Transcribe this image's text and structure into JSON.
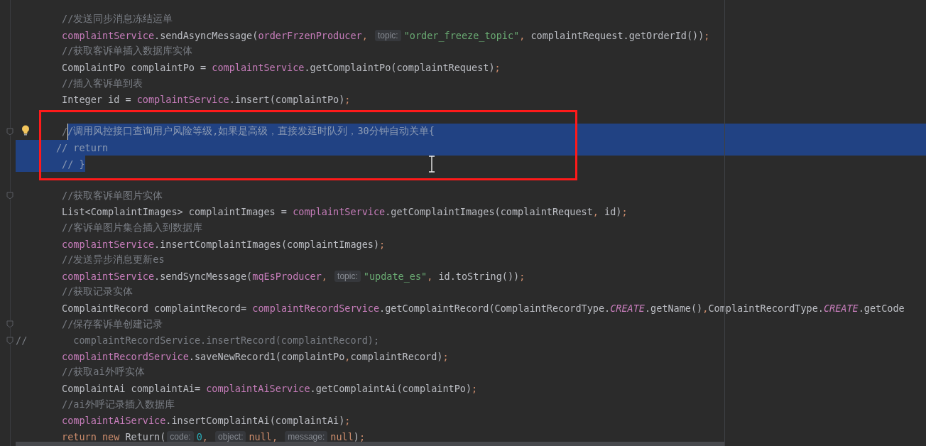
{
  "editor": {
    "lines": [
      {
        "kind": "code",
        "selected_to_end": false,
        "tokens": [
          {
            "kind": "comment",
            "text": "        //发送同步消息冻结运单"
          }
        ]
      },
      {
        "kind": "code",
        "selected_to_end": false,
        "tokens": [
          {
            "kind": "field",
            "text": "        complaintService"
          },
          {
            "kind": "plain",
            "text": ".sendAsyncMessage("
          },
          {
            "kind": "field",
            "text": "orderFrzenProducer"
          },
          {
            "kind": "punct",
            "text": ", "
          },
          {
            "kind": "hint",
            "text": "topic:"
          },
          {
            "kind": "string",
            "text": "\"order_freeze_topic\""
          },
          {
            "kind": "punct",
            "text": ", "
          },
          {
            "kind": "plain",
            "text": "complaintRequest.getOrderId())"
          },
          {
            "kind": "punct",
            "text": ";"
          }
        ]
      },
      {
        "kind": "code",
        "selected_to_end": false,
        "tokens": [
          {
            "kind": "comment",
            "text": "        //获取客诉单插入数据库实体"
          }
        ]
      },
      {
        "kind": "code",
        "selected_to_end": false,
        "tokens": [
          {
            "kind": "plain",
            "text": "        ComplaintPo complaintPo = "
          },
          {
            "kind": "field",
            "text": "complaintService"
          },
          {
            "kind": "plain",
            "text": ".getComplaintPo(complaintRequest)"
          },
          {
            "kind": "punct",
            "text": ";"
          }
        ]
      },
      {
        "kind": "code",
        "selected_to_end": false,
        "tokens": [
          {
            "kind": "comment",
            "text": "        //插入客诉单到表"
          }
        ]
      },
      {
        "kind": "code",
        "selected_to_end": false,
        "tokens": [
          {
            "kind": "plain",
            "text": "        Integer id = "
          },
          {
            "kind": "field",
            "text": "complaintService"
          },
          {
            "kind": "plain",
            "text": ".insert(complaintPo)"
          },
          {
            "kind": "punct",
            "text": ";"
          }
        ]
      },
      {
        "kind": "blank"
      },
      {
        "kind": "code",
        "selected_to_end": true,
        "markers": [
          {
            "kind": "fold"
          },
          {
            "kind": "bulb"
          }
        ],
        "tokens": [
          {
            "kind": "comment",
            "text": "        /"
          },
          {
            "kind": "comment",
            "selected": true,
            "text": "/调用风控接口查询用户风险等级,如果是高级，直接发延时队列，30分钟自动关单{"
          }
        ]
      },
      {
        "kind": "code",
        "selected_to_end": true,
        "tokens": [
          {
            "kind": "comment",
            "selected": true,
            "text": "       // return"
          }
        ]
      },
      {
        "kind": "code",
        "selected_to_end": false,
        "tokens": [
          {
            "kind": "comment",
            "selected": true,
            "text": "        // }"
          }
        ]
      },
      {
        "kind": "blank"
      },
      {
        "kind": "code",
        "selected_to_end": false,
        "markers": [
          {
            "kind": "fold"
          }
        ],
        "tokens": [
          {
            "kind": "comment",
            "text": "        //获取客诉单图片实体"
          }
        ]
      },
      {
        "kind": "code",
        "selected_to_end": false,
        "tokens": [
          {
            "kind": "plain",
            "text": "        List<ComplaintImages> complaintImages = "
          },
          {
            "kind": "field",
            "text": "complaintService"
          },
          {
            "kind": "plain",
            "text": ".getComplaintImages(complaintRequest"
          },
          {
            "kind": "punct",
            "text": ", "
          },
          {
            "kind": "plain",
            "text": "id)"
          },
          {
            "kind": "punct",
            "text": ";"
          }
        ]
      },
      {
        "kind": "code",
        "selected_to_end": false,
        "tokens": [
          {
            "kind": "comment",
            "text": "        //客诉单图片集合插入到数据库"
          }
        ]
      },
      {
        "kind": "code",
        "selected_to_end": false,
        "tokens": [
          {
            "kind": "field",
            "text": "        complaintService"
          },
          {
            "kind": "plain",
            "text": ".insertComplaintImages(complaintImages)"
          },
          {
            "kind": "punct",
            "text": ";"
          }
        ]
      },
      {
        "kind": "code",
        "selected_to_end": false,
        "tokens": [
          {
            "kind": "comment",
            "text": "        //发送异步消息更新es"
          }
        ]
      },
      {
        "kind": "code",
        "selected_to_end": false,
        "tokens": [
          {
            "kind": "field",
            "text": "        complaintService"
          },
          {
            "kind": "plain",
            "text": ".sendSyncMessage("
          },
          {
            "kind": "field",
            "text": "mqEsProducer"
          },
          {
            "kind": "punct",
            "text": ", "
          },
          {
            "kind": "hint",
            "text": "topic:"
          },
          {
            "kind": "string",
            "text": "\"update_es\""
          },
          {
            "kind": "punct",
            "text": ", "
          },
          {
            "kind": "plain",
            "text": "id.toString())"
          },
          {
            "kind": "punct",
            "text": ";"
          }
        ]
      },
      {
        "kind": "code",
        "selected_to_end": false,
        "tokens": [
          {
            "kind": "comment",
            "text": "        //获取记录实体"
          }
        ]
      },
      {
        "kind": "code",
        "selected_to_end": false,
        "tokens": [
          {
            "kind": "plain",
            "text": "        ComplaintRecord complaintRecord= "
          },
          {
            "kind": "field",
            "text": "complaintRecordService"
          },
          {
            "kind": "plain",
            "text": ".getComplaintRecord(ComplaintRecordType."
          },
          {
            "kind": "constant",
            "text": "CREATE"
          },
          {
            "kind": "plain",
            "text": ".getName()"
          },
          {
            "kind": "punct",
            "text": ","
          },
          {
            "kind": "plain",
            "text": "ComplaintRecordType."
          },
          {
            "kind": "constant",
            "text": "CREATE"
          },
          {
            "kind": "plain",
            "text": ".getCode"
          }
        ]
      },
      {
        "kind": "code",
        "selected_to_end": false,
        "markers": [
          {
            "kind": "fold"
          }
        ],
        "tokens": [
          {
            "kind": "comment",
            "text": "        //保存客诉单创建记录"
          }
        ]
      },
      {
        "kind": "code",
        "selected_to_end": false,
        "markers": [
          {
            "kind": "fold"
          }
        ],
        "tokens": [
          {
            "kind": "comment",
            "text": "//        complaintRecordService.insertRecord(complaintRecord);"
          }
        ]
      },
      {
        "kind": "code",
        "selected_to_end": false,
        "tokens": [
          {
            "kind": "field",
            "text": "        complaintRecordService"
          },
          {
            "kind": "plain",
            "text": ".saveNewRecord1(complaintPo"
          },
          {
            "kind": "punct",
            "text": ","
          },
          {
            "kind": "plain",
            "text": "complaintRecord)"
          },
          {
            "kind": "punct",
            "text": ";"
          }
        ]
      },
      {
        "kind": "code",
        "selected_to_end": false,
        "tokens": [
          {
            "kind": "comment",
            "text": "        //获取ai外呼实体"
          }
        ]
      },
      {
        "kind": "code",
        "selected_to_end": false,
        "tokens": [
          {
            "kind": "plain",
            "text": "        ComplaintAi complaintAi= "
          },
          {
            "kind": "field",
            "text": "complaintAiService"
          },
          {
            "kind": "plain",
            "text": ".getComplaintAi(complaintPo)"
          },
          {
            "kind": "punct",
            "text": ";"
          }
        ]
      },
      {
        "kind": "code",
        "selected_to_end": false,
        "tokens": [
          {
            "kind": "comment",
            "text": "        //ai外呼记录插入数据库"
          }
        ]
      },
      {
        "kind": "code",
        "selected_to_end": false,
        "tokens": [
          {
            "kind": "field",
            "text": "        complaintAiService"
          },
          {
            "kind": "plain",
            "text": ".insertComplaintAi(complaintAi)"
          },
          {
            "kind": "punct",
            "text": ";"
          }
        ]
      },
      {
        "kind": "code",
        "selected_to_end": false,
        "tokens": [
          {
            "kind": "keyword",
            "text": "        return new "
          },
          {
            "kind": "plain",
            "text": "Return("
          },
          {
            "kind": "hint",
            "text": "code:"
          },
          {
            "kind": "number",
            "text": "0"
          },
          {
            "kind": "punct",
            "text": ", "
          },
          {
            "kind": "hint",
            "text": "object:"
          },
          {
            "kind": "keyword",
            "text": "null"
          },
          {
            "kind": "punct",
            "text": ", "
          },
          {
            "kind": "hint",
            "text": "message:"
          },
          {
            "kind": "keyword",
            "text": "null"
          },
          {
            "kind": "plain",
            "text": ")"
          },
          {
            "kind": "punct",
            "text": ";"
          }
        ]
      }
    ]
  }
}
